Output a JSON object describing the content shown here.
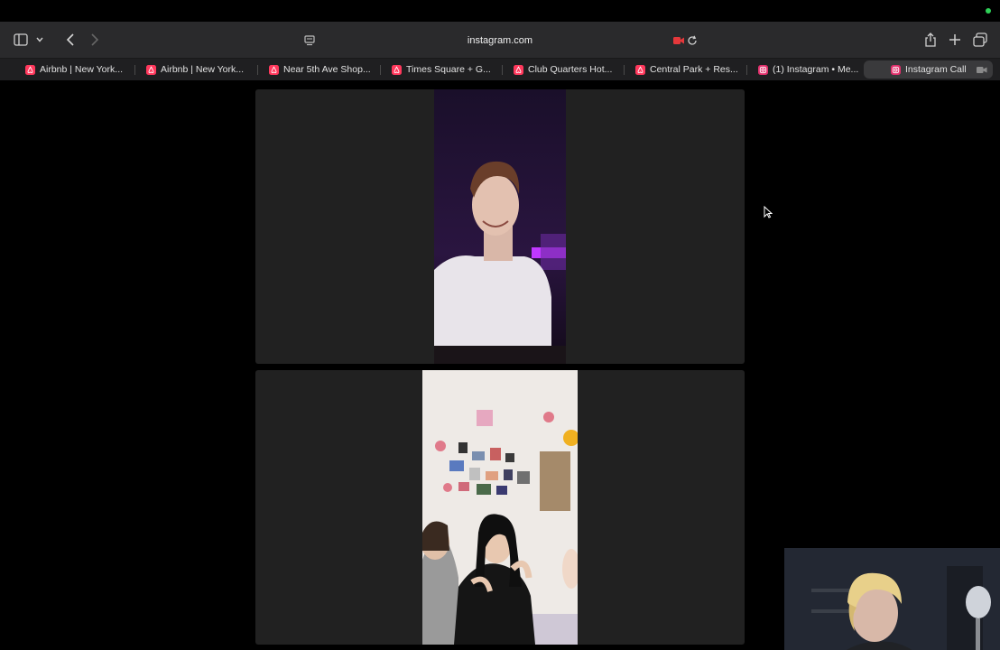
{
  "browser": {
    "address_url": "instagram.com"
  },
  "tabs": [
    {
      "label": "Airbnb | New York...",
      "favicon": "airbnb-icon"
    },
    {
      "label": "Airbnb | New York...",
      "favicon": "airbnb-icon"
    },
    {
      "label": "Near 5th Ave Shop...",
      "favicon": "airbnb-icon"
    },
    {
      "label": "Times Square + G...",
      "favicon": "airbnb-icon"
    },
    {
      "label": "Club Quarters Hot...",
      "favicon": "airbnb-icon"
    },
    {
      "label": "Central Park + Res...",
      "favicon": "airbnb-icon"
    },
    {
      "label": "(1) Instagram • Me...",
      "favicon": "instagram-icon"
    },
    {
      "label": "Instagram Call",
      "favicon": "instagram-icon",
      "active": true
    }
  ],
  "colors": {
    "airbnb": "#ff385c",
    "instagram": "#e1306c",
    "camera_recording": "#e5383b",
    "status_dot": "#2fd158"
  },
  "call": {
    "participants": [
      "remote-participant-1",
      "remote-participant-2"
    ],
    "self_view": "local-camera"
  }
}
